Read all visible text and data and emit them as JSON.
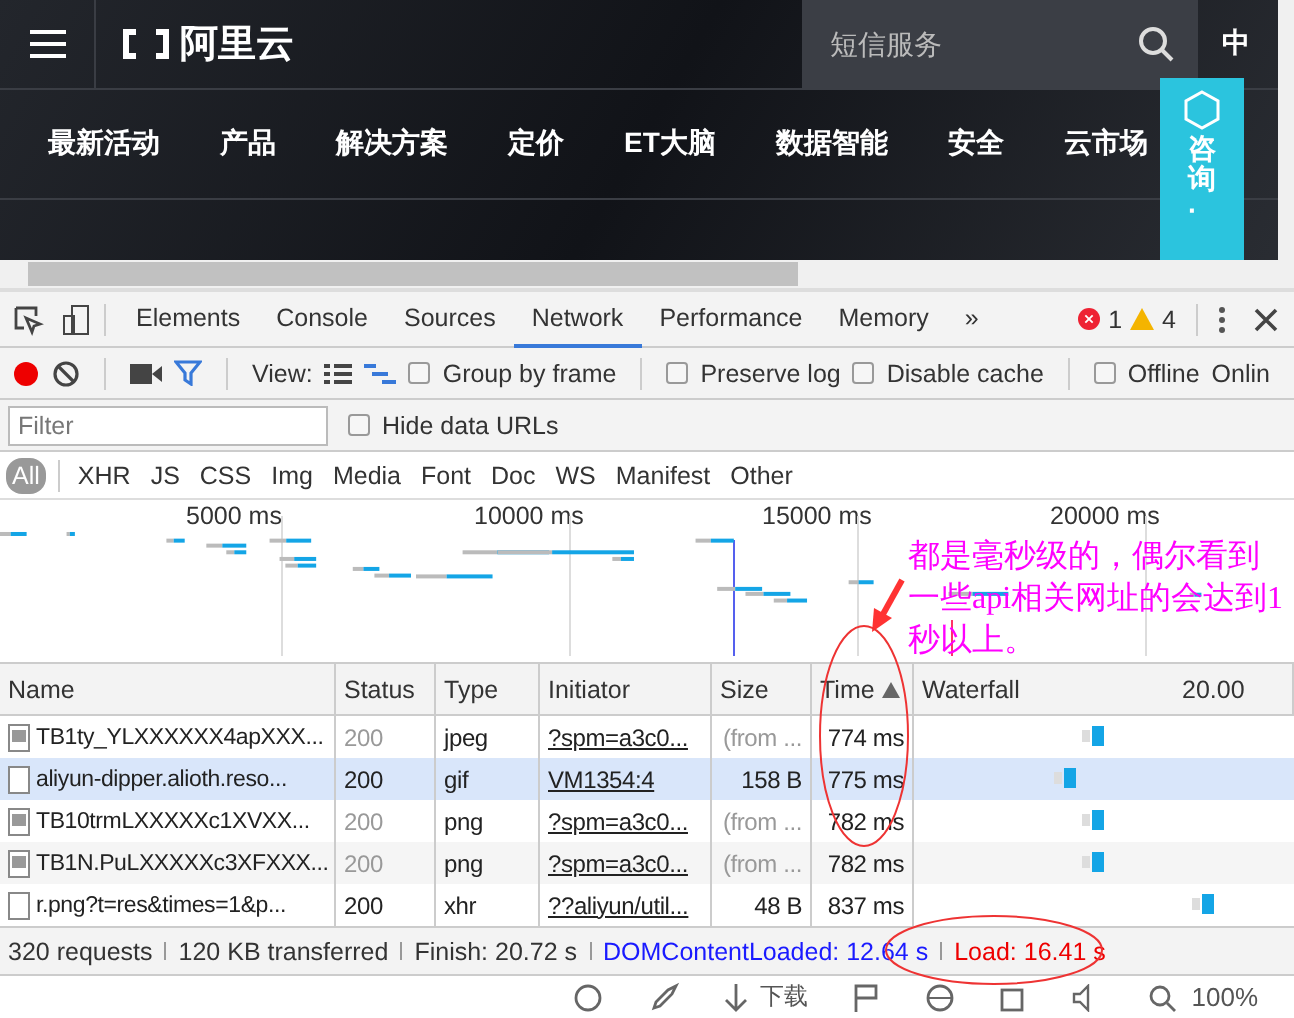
{
  "site": {
    "logo": "阿里云",
    "search": {
      "placeholder": "短信服务"
    },
    "region": "中",
    "nav": [
      "最新活动",
      "产品",
      "解决方案",
      "定价",
      "ET大脑",
      "数据智能",
      "安全",
      "云市场"
    ],
    "consult": "咨询·"
  },
  "devtools": {
    "tabs": [
      {
        "label": "Elements",
        "selected": false
      },
      {
        "label": "Console",
        "selected": false
      },
      {
        "label": "Sources",
        "selected": false
      },
      {
        "label": "Network",
        "selected": true
      },
      {
        "label": "Performance",
        "selected": false
      },
      {
        "label": "Memory",
        "selected": false
      }
    ],
    "more": "»",
    "errors": "1",
    "warnings": "4",
    "toolbar": {
      "recording": true,
      "filter_active": true,
      "view_label": "View:",
      "waterfall_view": true,
      "options": [
        {
          "label": "Group by frame",
          "checked": false
        },
        {
          "label": "Preserve log",
          "checked": false
        },
        {
          "label": "Disable cache",
          "checked": false
        },
        {
          "label": "Offline",
          "checked": false
        }
      ],
      "throttle": "Onlin"
    },
    "filter": {
      "placeholder": "Filter",
      "hide_data_urls": {
        "label": "Hide data URLs",
        "checked": false
      }
    },
    "types": [
      {
        "label": "All",
        "selected": true
      },
      {
        "label": "XHR",
        "selected": false
      },
      {
        "label": "JS",
        "selected": false
      },
      {
        "label": "CSS",
        "selected": false
      },
      {
        "label": "Img",
        "selected": false
      },
      {
        "label": "Media",
        "selected": false
      },
      {
        "label": "Font",
        "selected": false
      },
      {
        "label": "Doc",
        "selected": false
      },
      {
        "label": "WS",
        "selected": false
      },
      {
        "label": "Manifest",
        "selected": false
      },
      {
        "label": "Other",
        "selected": false
      }
    ],
    "overview_ticks": [
      "5000 ms",
      "10000 ms",
      "15000 ms",
      "20000 ms"
    ],
    "columns": [
      "Name",
      "Status",
      "Type",
      "Initiator",
      "Size",
      "Time",
      "Waterfall"
    ],
    "waterfall_tick": "20.00",
    "rows": [
      {
        "kind": "image",
        "name": "TB1ty_YLXXXXXX4apXXX...",
        "status": "200",
        "cached": true,
        "type": "jpeg",
        "initiator": "?spm=a3c0...",
        "size": "(from ...",
        "time": "774 ms",
        "selected": false
      },
      {
        "kind": "document",
        "name": "aliyun-dipper.alioth.reso...",
        "status": "200",
        "cached": false,
        "type": "gif",
        "initiator": "VM1354:4",
        "size": "158 B",
        "time": "775 ms",
        "selected": true
      },
      {
        "kind": "image",
        "name": "TB10trmLXXXXXc1XVXX...",
        "status": "200",
        "cached": true,
        "type": "png",
        "initiator": "?spm=a3c0...",
        "size": "(from ...",
        "time": "782 ms",
        "selected": false
      },
      {
        "kind": "image",
        "name": "TB1N.PuLXXXXXc3XFXXX...",
        "status": "200",
        "cached": true,
        "type": "png",
        "initiator": "?spm=a3c0...",
        "size": "(from ...",
        "time": "782 ms",
        "selected": false
      },
      {
        "kind": "document",
        "name": "r.png?t=res&times=1&p...",
        "status": "200",
        "cached": false,
        "type": "xhr",
        "initiator": "??aliyun/util...",
        "size": "48 B",
        "time": "837 ms",
        "selected": false
      }
    ],
    "summary": [
      {
        "kind": "plain",
        "text": "320 requests"
      },
      {
        "kind": "plain",
        "text": "120 KB transferred"
      },
      {
        "kind": "plain",
        "text": "Finish: 20.72 s"
      },
      {
        "kind": "dom",
        "text": "DOMContentLoaded: 12.64 s"
      },
      {
        "kind": "load",
        "text": "Load: 16.41 s"
      }
    ]
  },
  "annotation": {
    "text": "都是毫秒级的，偶尔看到一些api相关网址的会达到1秒以上。"
  },
  "browser_status": {
    "download": "下载",
    "zoom": "100%"
  }
}
